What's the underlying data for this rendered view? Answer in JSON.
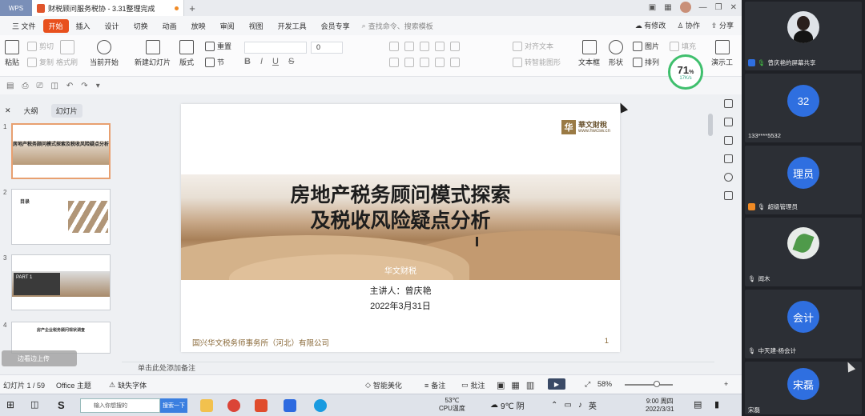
{
  "titlebar": {
    "app_tab": "WPS",
    "doc_title": "财税顾问服务税协 - 3.31整理完成",
    "new_tab": "+"
  },
  "menu": {
    "items": [
      "三 文件",
      "开始",
      "插入",
      "设计",
      "切换",
      "动画",
      "放映",
      "审阅",
      "视图",
      "开发工具",
      "会员专享"
    ],
    "active": "开始",
    "search_placeholder": "查找命令、搜索模板",
    "right": [
      "有修改",
      "协作",
      "分享"
    ]
  },
  "ribbon": {
    "paste": "粘贴",
    "cut": "剪切",
    "copy": "复制",
    "format_painter": "格式刷",
    "from_current": "当前开始",
    "new_slide": "新建幻灯片",
    "layout": "版式",
    "section": "节",
    "reset": "重置",
    "font_size": "0",
    "align_text": "对齐文本",
    "convert_smartart": "转智能图形",
    "textbox": "文本框",
    "shape": "形状",
    "arrange": "排列",
    "picture": "图片",
    "fill": "填充",
    "present_tool": "演示工",
    "bold": "B",
    "italic": "I",
    "underline": "U",
    "strike": "S"
  },
  "net_meter": {
    "percent": "71",
    "unit": "%",
    "speed": "17K/s"
  },
  "left_panel": {
    "tabs": [
      "大纲",
      "幻灯片"
    ],
    "selected_tab": "幻灯片",
    "thumbs": [
      {
        "num": "1",
        "title": "房地产税务顾问模式探索及税收风险疑点分析"
      },
      {
        "num": "2",
        "title": "目录"
      },
      {
        "num": "3",
        "title": "PART 1"
      },
      {
        "num": "4",
        "title": "房产企业税务顾问现状调查"
      }
    ],
    "popup": "边看边上传"
  },
  "slide": {
    "logo_mark": "华",
    "logo_name": "華文財稅",
    "logo_url": "www.hwcsw.cn",
    "title_line1": "房地产税务顾问模式探索",
    "title_line2": "及税收风险疑点分析",
    "brand": "华文财税",
    "presenter": "主讲人：曾庆艳",
    "date": "2022年3月31日",
    "company": "国兴华文税务师事务所（河北）有限公司",
    "page_num": "1"
  },
  "notes_placeholder": "单击此处添加备注",
  "statusbar": {
    "slide_count": "幻灯片 1 / 59",
    "theme": "Office 主题",
    "missing_font": "缺失字体",
    "smart_beautify": "智能美化",
    "notes": "备注",
    "comments": "批注",
    "zoom": "58%"
  },
  "taskbar": {
    "search_text": "输入你想搜的",
    "search_btn": "搜索一下",
    "cpu_temp": "53℃",
    "cpu_label": "CPU温度",
    "weather": "9℃ 阴",
    "ime": "英",
    "time": "9:00 周四",
    "date": "2022/3/31"
  },
  "meeting": {
    "tiles": [
      {
        "type": "photo",
        "name": "曾庆艳的屏幕共享"
      },
      {
        "type": "avatar",
        "label": "32",
        "name": "133****5532"
      },
      {
        "type": "avatar",
        "label": "理员",
        "name": "超级管理员"
      },
      {
        "type": "photo",
        "name": "闻木"
      },
      {
        "type": "avatar",
        "label": "会计",
        "name": "中天建-杨会计"
      },
      {
        "type": "avatar",
        "label": "宋磊",
        "name": "宋磊"
      }
    ]
  },
  "colors": {
    "accent": "#e8501d",
    "meeting_avatar": "#2f6fe0",
    "meter_ring": "#3fbf6d"
  }
}
